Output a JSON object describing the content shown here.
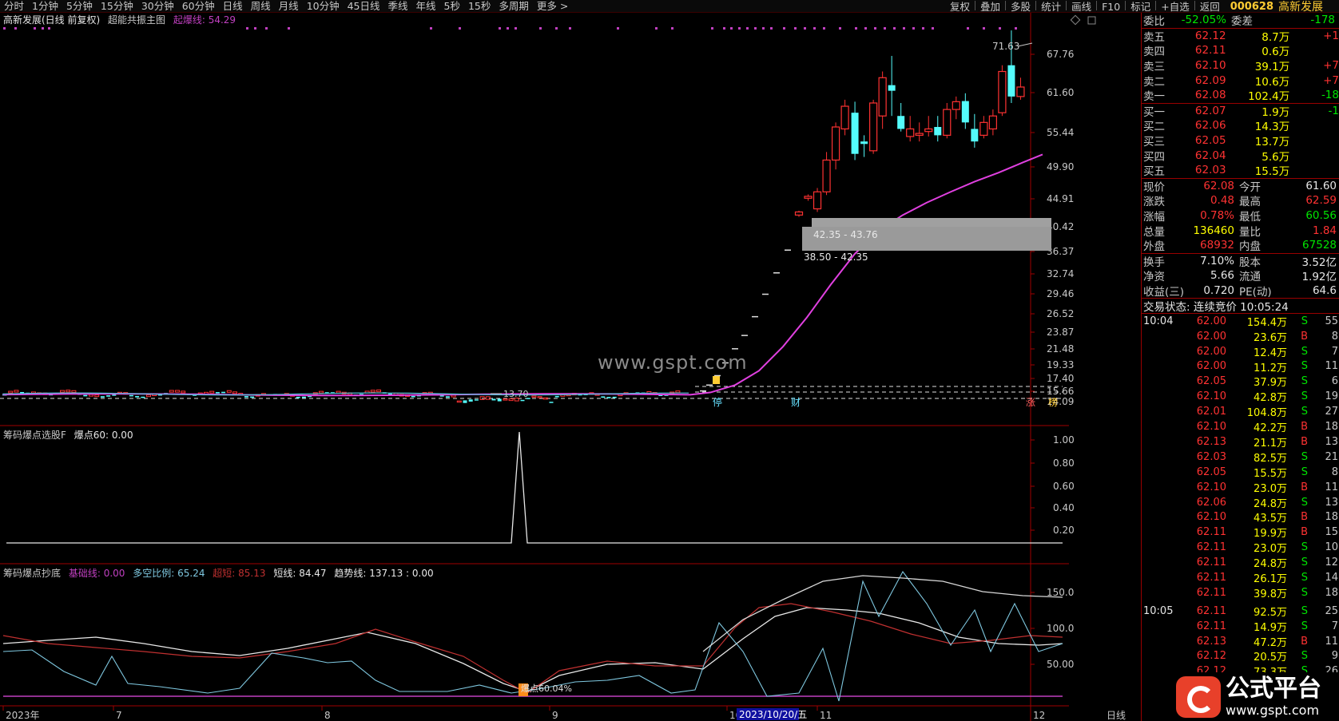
{
  "toolbar": {
    "periods": [
      "分时",
      "1分钟",
      "5分钟",
      "15分钟",
      "30分钟",
      "60分钟",
      "日线",
      "周线",
      "月线",
      "10分钟",
      "45日线",
      "季线",
      "年线",
      "5秒",
      "15秒",
      "多周期",
      "更多 >"
    ],
    "tools": [
      "复权",
      "叠加",
      "多股",
      "统计",
      "画线",
      "F10",
      "标记",
      "+自选",
      "返回"
    ]
  },
  "stock": {
    "code": "000628",
    "name": "高新发展"
  },
  "main_header": {
    "title": "高新发展(日线 前复权)",
    "indicator": "超能共振主图",
    "line_label": "起爆线: 54.29"
  },
  "sub1_header": {
    "indicator": "筹码爆点选股F",
    "value_label": "爆点60: 0.00"
  },
  "sub2_header": {
    "indicator": "筹码爆点抄底",
    "base": "基础线: 0.00",
    "ratio": "多空比例: 65.24",
    "super": "超短: 85.13",
    "short": "短线: 84.47",
    "trend": "趋势线: 137.13 : 0.00"
  },
  "axis_main": [
    "67.76",
    "61.60",
    "55.44",
    "49.90",
    "44.91",
    "40.42",
    "36.37",
    "32.74",
    "29.46",
    "26.52",
    "23.87",
    "21.48",
    "19.33",
    "17.40",
    "15.66",
    "14.09"
  ],
  "axis_sub1": [
    "1.00",
    "0.80",
    "0.60",
    "0.40",
    "0.20"
  ],
  "axis_sub2": [
    "150.0",
    "100.0",
    "50.00"
  ],
  "x_axis": {
    "labels": [
      "2023年",
      "7",
      "8",
      "9",
      "10",
      "11",
      "12"
    ],
    "cursor_date": "2023/10/20/五",
    "period": "日线"
  },
  "annotations": {
    "high": "71.63",
    "low": "13.70",
    "zone_upper": "42.35 - 43.76",
    "zone_lower": "38.50 - 42.35",
    "signal_sub2": "爆点60.04%",
    "markers": [
      {
        "text": "停",
        "color": "#66e0ff"
      },
      {
        "text": "财",
        "color": "#66e0ff"
      },
      {
        "text": "涨",
        "color": "#ff6060"
      },
      {
        "text": "榜",
        "color": "#ffcc33"
      }
    ]
  },
  "watermark": "www.gspt.com",
  "panel": {
    "weibi": {
      "label": "委比",
      "value": "-52.05%",
      "label2": "委差",
      "value2": "-178"
    },
    "asks": [
      {
        "label": "卖五",
        "price": "62.12",
        "vol": "8.7万",
        "chg": "+1"
      },
      {
        "label": "卖四",
        "price": "62.11",
        "vol": "0.6万",
        "chg": ""
      },
      {
        "label": "卖三",
        "price": "62.10",
        "vol": "39.1万",
        "chg": "+7"
      },
      {
        "label": "卖二",
        "price": "62.09",
        "vol": "10.6万",
        "chg": "+7"
      },
      {
        "label": "卖一",
        "price": "62.08",
        "vol": "102.4万",
        "chg": "-18"
      }
    ],
    "bids": [
      {
        "label": "买一",
        "price": "62.07",
        "vol": "1.9万",
        "chg": "-1"
      },
      {
        "label": "买二",
        "price": "62.06",
        "vol": "14.3万",
        "chg": ""
      },
      {
        "label": "买三",
        "price": "62.05",
        "vol": "13.7万",
        "chg": ""
      },
      {
        "label": "买四",
        "price": "62.04",
        "vol": "5.6万",
        "chg": ""
      },
      {
        "label": "买五",
        "price": "62.03",
        "vol": "15.5万",
        "chg": ""
      }
    ],
    "quote": [
      {
        "k": "现价",
        "v": "62.08",
        "vc": "red",
        "k2": "今开",
        "v2": "61.60",
        "v2c": "white"
      },
      {
        "k": "涨跌",
        "v": "0.48",
        "vc": "red",
        "k2": "最高",
        "v2": "62.59",
        "v2c": "red"
      },
      {
        "k": "涨幅",
        "v": "0.78%",
        "vc": "red",
        "k2": "最低",
        "v2": "60.56",
        "v2c": "green"
      },
      {
        "k": "总量",
        "v": "136460",
        "vc": "yellow",
        "k2": "量比",
        "v2": "1.84",
        "v2c": "red"
      },
      {
        "k": "外盘",
        "v": "68932",
        "vc": "red",
        "k2": "内盘",
        "v2": "67528",
        "v2c": "green"
      }
    ],
    "fund": [
      {
        "k": "换手",
        "v": "7.10%",
        "k2": "股本",
        "v2": "3.52亿"
      },
      {
        "k": "净资",
        "v": "5.66",
        "k2": "流通",
        "v2": "1.92亿"
      },
      {
        "k": "收益(三)",
        "v": "0.720",
        "k2": "PE(动)",
        "v2": "64.6"
      }
    ],
    "status": "交易状态: 连续竞价 10:05:24",
    "ticks_1004_label": "10:04",
    "ticks_1005_label": "10:05",
    "ticks_1004": [
      [
        "62.00",
        "154.4万",
        "S",
        "55"
      ],
      [
        "62.00",
        "23.6万",
        "B",
        "8"
      ],
      [
        "62.00",
        "12.4万",
        "S",
        "7"
      ],
      [
        "62.00",
        "11.2万",
        "S",
        "11"
      ],
      [
        "62.05",
        "37.9万",
        "S",
        "6"
      ],
      [
        "62.10",
        "42.8万",
        "S",
        "19"
      ],
      [
        "62.01",
        "104.8万",
        "S",
        "27"
      ],
      [
        "62.10",
        "42.2万",
        "B",
        "18"
      ],
      [
        "62.13",
        "21.1万",
        "B",
        "13"
      ],
      [
        "62.03",
        "82.5万",
        "S",
        "21"
      ],
      [
        "62.05",
        "15.5万",
        "S",
        "8"
      ],
      [
        "62.10",
        "23.0万",
        "B",
        "11"
      ],
      [
        "62.06",
        "24.8万",
        "S",
        "13"
      ],
      [
        "62.10",
        "43.5万",
        "B",
        "18"
      ],
      [
        "62.11",
        "19.9万",
        "B",
        "15"
      ],
      [
        "62.11",
        "23.0万",
        "S",
        "10"
      ],
      [
        "62.11",
        "24.8万",
        "S",
        "12"
      ],
      [
        "62.11",
        "26.1万",
        "S",
        "14"
      ],
      [
        "62.11",
        "39.8万",
        "S",
        "18"
      ]
    ],
    "ticks_1005": [
      [
        "62.11",
        "92.5万",
        "S",
        "25"
      ],
      [
        "62.11",
        "14.9万",
        "S",
        "7"
      ],
      [
        "62.13",
        "47.2万",
        "B",
        "11"
      ],
      [
        "62.12",
        "20.5万",
        "S",
        "9"
      ],
      [
        "62.12",
        "73.3万",
        "S",
        "26"
      ]
    ]
  },
  "logo": {
    "title": "公式平台",
    "url": "www.gspt.com"
  },
  "colors": {
    "up": "#ff3232",
    "down": "#54fcfc",
    "ma": "#e040e0",
    "purple": "#c040c0",
    "zone": "#a0a0a0",
    "sub_white": "#e8e8e8",
    "sub_red": "#c03030",
    "sub_cyan": "#7fc8e0"
  }
}
